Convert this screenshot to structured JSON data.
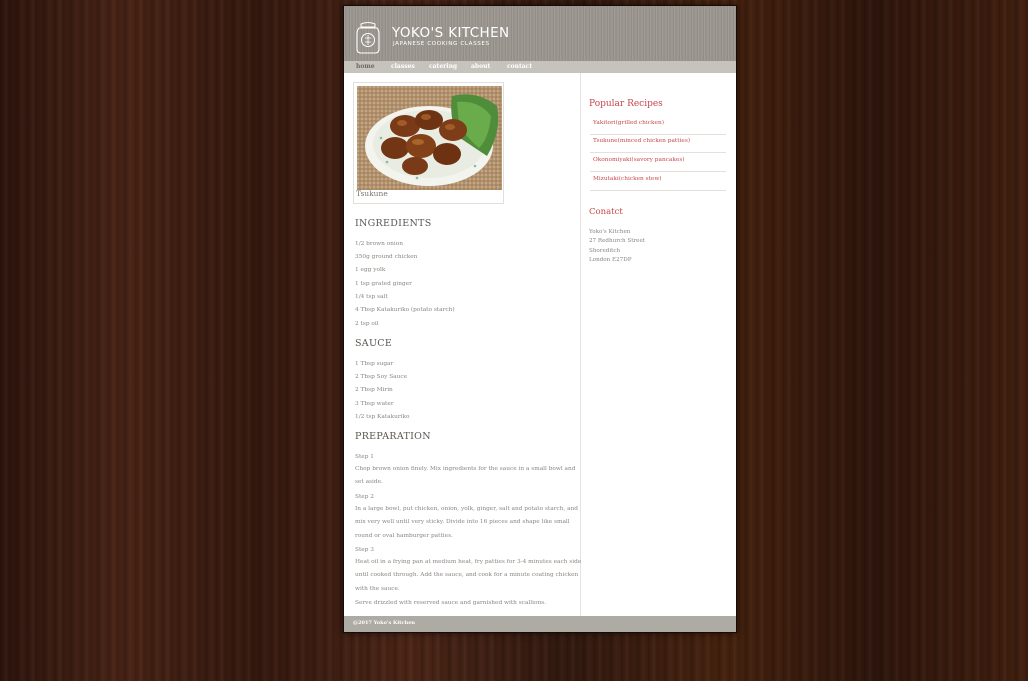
{
  "header": {
    "brand_title": "YOKO'S KITCHEN",
    "brand_subtitle": "JAPANESE COOKING CLASSES"
  },
  "nav": {
    "items": [
      {
        "label": "home",
        "active": true
      },
      {
        "label": "classes"
      },
      {
        "label": "catering"
      },
      {
        "label": "about"
      },
      {
        "label": "contact"
      }
    ]
  },
  "main": {
    "figure_caption": "Tsukune",
    "ingredients_heading": "INGREDIENTS",
    "ingredients": [
      "1/2 brown onion",
      "350g ground chicken",
      "1 egg yolk",
      "1 tsp grated ginger",
      "1/4 tsp salt",
      "4 Tbsp Katakuriko (potato starch)",
      "2 tsp oil"
    ],
    "sauce_heading": "SAUCE",
    "sauce": [
      "1 Tbsp sugar",
      "2 Tbsp Soy Sauce",
      "2 Tbsp Mirin",
      "3 Tbsp water",
      "1/2 tsp Katakuriko"
    ],
    "preparation_heading": "PREPARATION",
    "steps": [
      {
        "label": "Step 1",
        "text": "Chop brown onion finely. Mix ingredients for the sauce in a small bowl and set aside."
      },
      {
        "label": "Step 2",
        "text": "In a large bowl, put chicken, onion, yolk, ginger, salt and potato starch, and mix very well until very sticky. Divide into 16 pieces and shape like small round or oval hamburger patties."
      },
      {
        "label": "Step 3",
        "text": "Heat oil in a frying pan at medium heat, fry patties for 3-4 minutes each side until cooked through. Add the sauce, and cook for a minute coating chicken with the sauce."
      }
    ],
    "closing": "Serve drizzled with reserved sauce and garnished with scallions."
  },
  "sidebar": {
    "popular_title": "Popular Recipes",
    "recipes": [
      "Yakitori(grilled chicken)",
      "Tsukune(minced chicken patties)",
      "Okonomiyaki(savory pancakes)",
      "Mizutaki(chicken stew)"
    ],
    "contact_title": "Conatct",
    "address": [
      "Yoko's Kitchen",
      "27 Redhurch Street",
      "Shoreditch",
      "London E27DP"
    ]
  },
  "footer": {
    "copyright": "@2017 Yoko's Kitchen"
  },
  "colors": {
    "accent": "#c7474a",
    "header_bg": "#9c9690",
    "footer_bg": "#aeaba5",
    "nav_bg": "#c6c3bd",
    "body_text": "#8a8580"
  },
  "icons": {
    "logo": "kitchen-jar-icon"
  }
}
